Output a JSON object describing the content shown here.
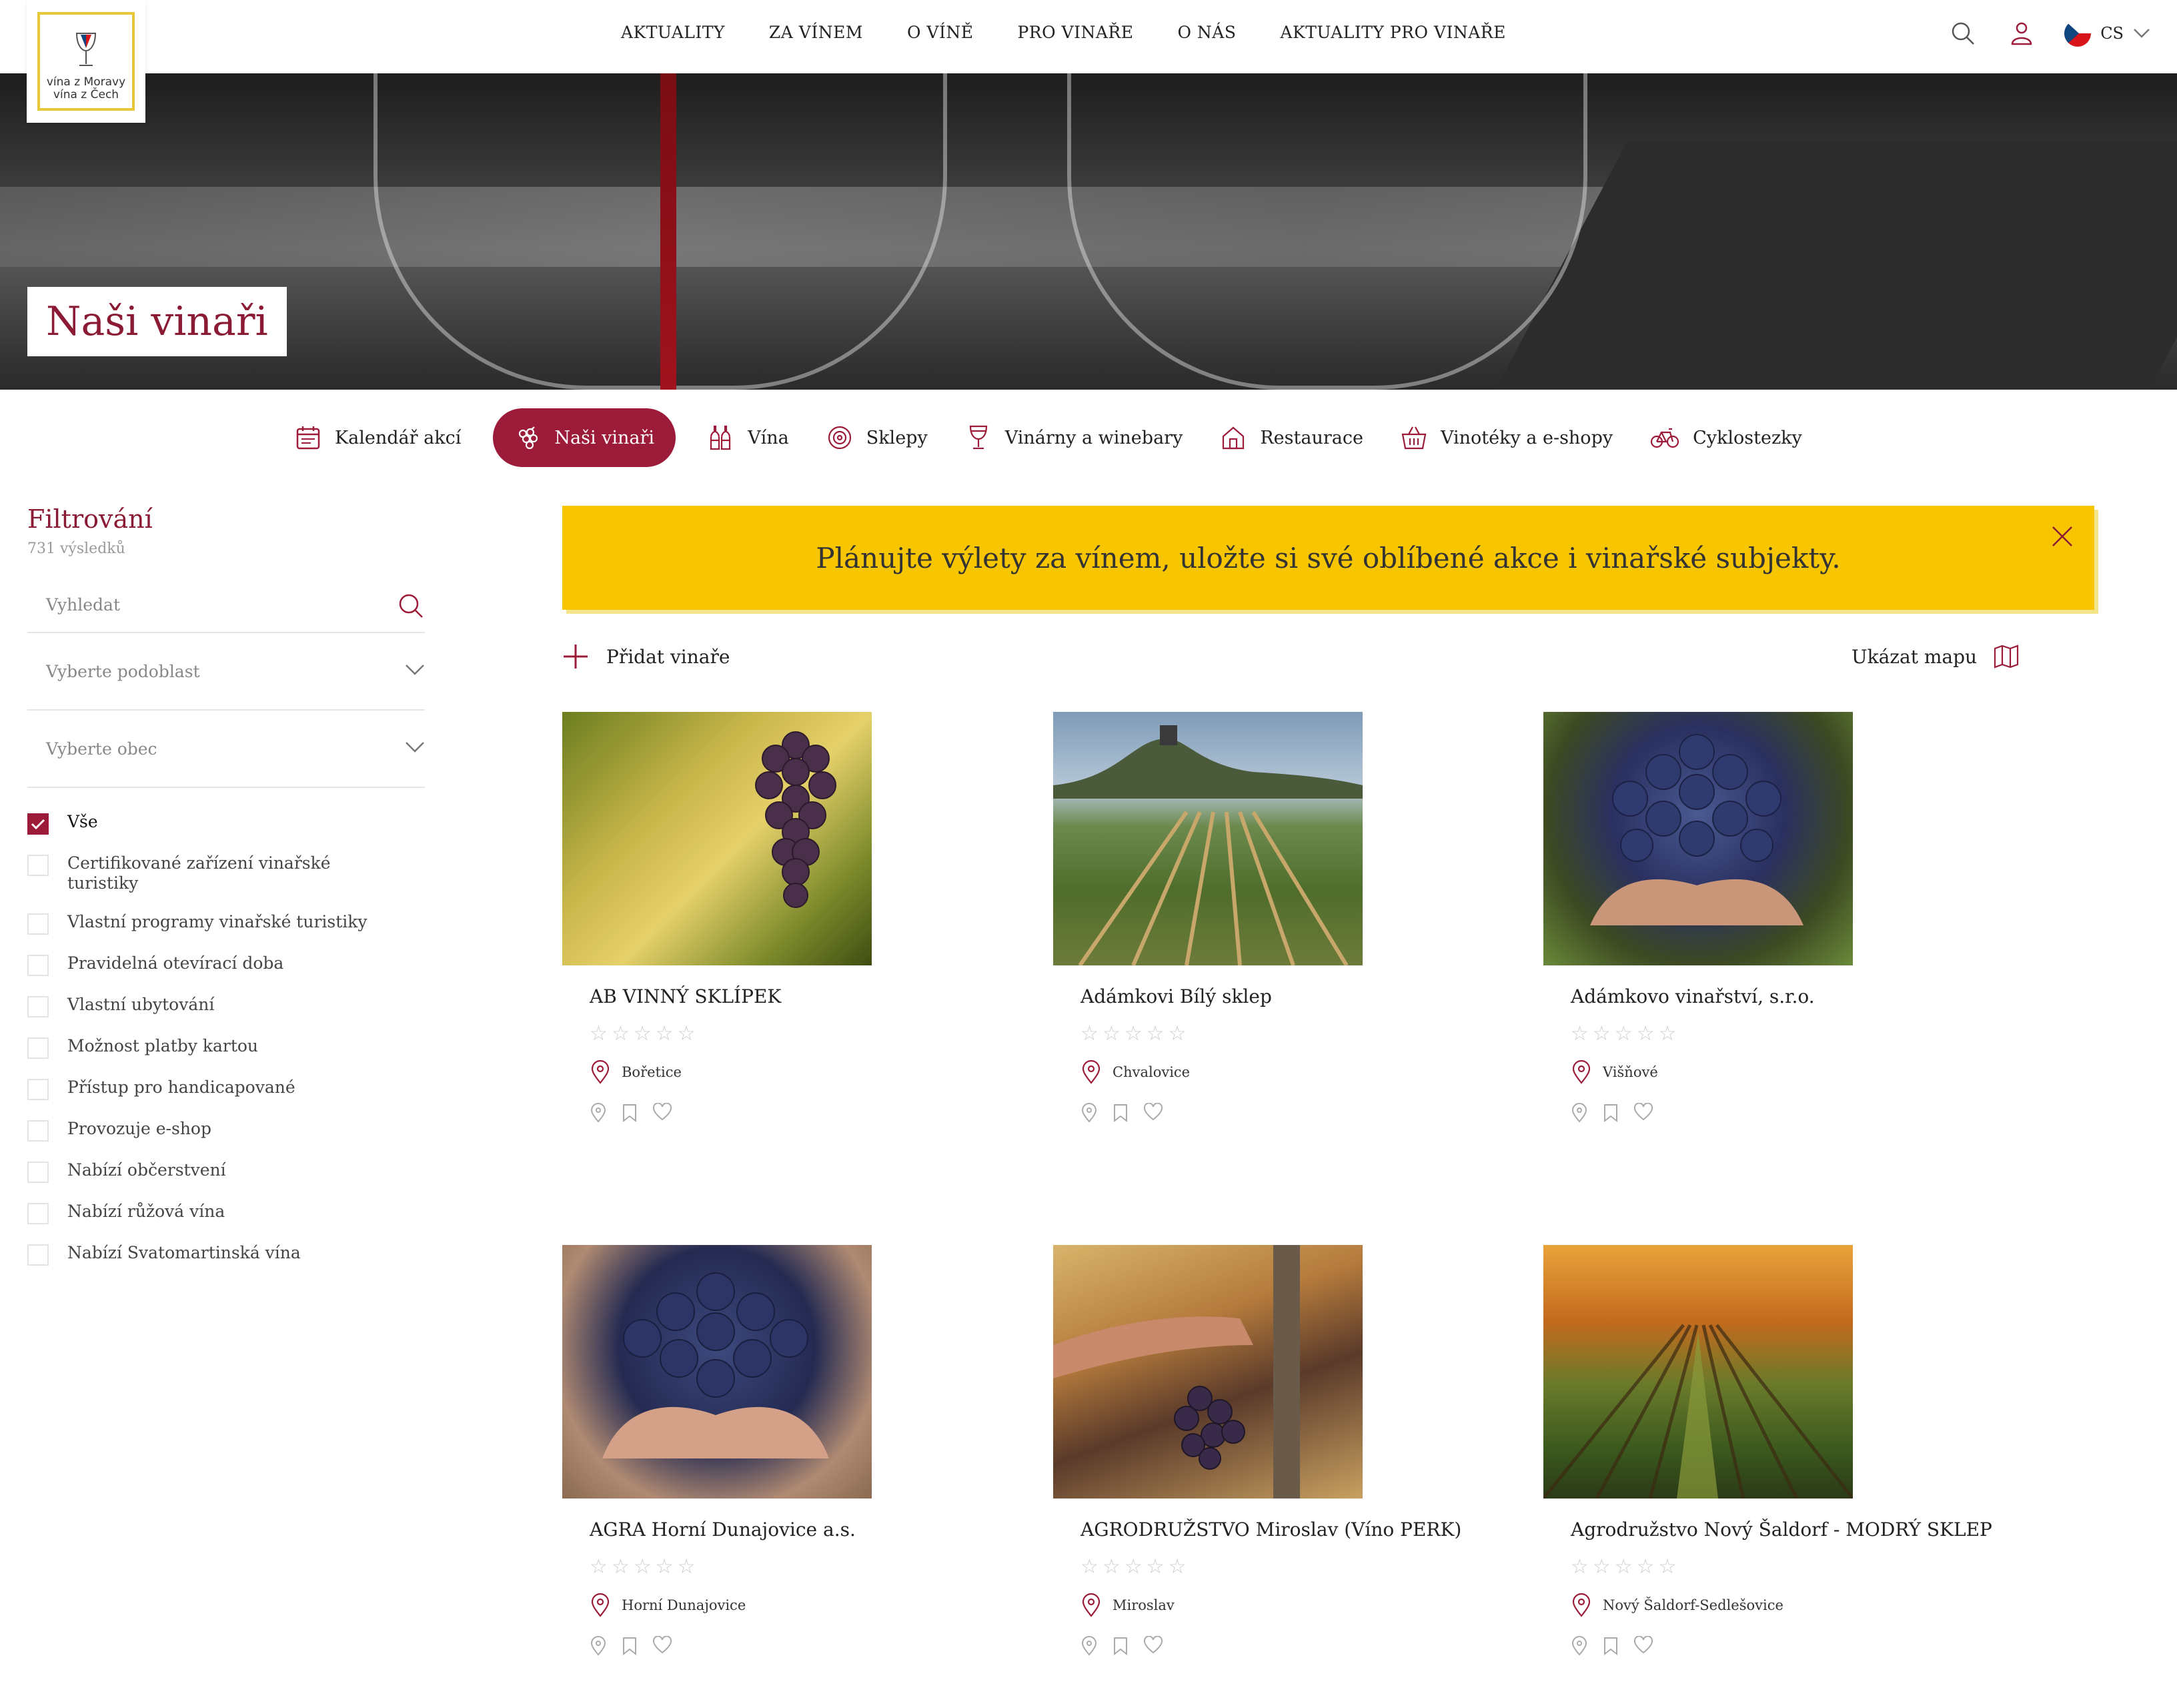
{
  "logo": {
    "line1": "vína z Moravy",
    "line2": "vína z Čech"
  },
  "nav": {
    "items": [
      "AKTUALITY",
      "ZA VÍNEM",
      "O VÍNĚ",
      "PRO VINAŘE",
      "O NÁS",
      "AKTUALITY PRO VINAŘE"
    ],
    "lang": "CS"
  },
  "hero": {
    "title": "Naši vinaři"
  },
  "categories": [
    {
      "label": "Kalendář akcí",
      "icon": "calendar-icon"
    },
    {
      "label": "Naši vinaři",
      "icon": "grapes-icon",
      "active": true
    },
    {
      "label": "Vína",
      "icon": "bottles-icon"
    },
    {
      "label": "Sklepy",
      "icon": "barrel-icon"
    },
    {
      "label": "Vinárny a winebary",
      "icon": "wine-glass-icon"
    },
    {
      "label": "Restaurace",
      "icon": "house-icon"
    },
    {
      "label": "Vinotéky a e-shopy",
      "icon": "basket-icon"
    },
    {
      "label": "Cyklostezky",
      "icon": "bicycle-icon"
    }
  ],
  "filter": {
    "title": "Filtrování",
    "count": "731 výsledků",
    "search_placeholder": "Vyhledat",
    "subregion_placeholder": "Vyberte podoblast",
    "town_placeholder": "Vyberte obec",
    "options": [
      {
        "label": "Vše",
        "checked": true
      },
      {
        "label": "Certifikované zařízení vinařské turistiky",
        "checked": false
      },
      {
        "label": "Vlastní programy vinařské turistiky",
        "checked": false
      },
      {
        "label": "Pravidelná otevírací doba",
        "checked": false
      },
      {
        "label": "Vlastní ubytování",
        "checked": false
      },
      {
        "label": "Možnost platby kartou",
        "checked": false
      },
      {
        "label": "Přístup pro handicapované",
        "checked": false
      },
      {
        "label": "Provozuje e-shop",
        "checked": false
      },
      {
        "label": "Nabízí občerstvení",
        "checked": false
      },
      {
        "label": "Nabízí růžová vína",
        "checked": false
      },
      {
        "label": "Nabízí Svatomartinská vína",
        "checked": false
      }
    ]
  },
  "banner": {
    "text": "Plánujte výlety za vínem, uložte si své oblíbené akce i vinařské subjekty."
  },
  "toolbar": {
    "add_label": "Přidat vinaře",
    "map_label": "Ukázat mapu"
  },
  "winemakers": [
    {
      "name": "AB VINNÝ SKLÍPEK",
      "town": "Bořetice",
      "rating": 0
    },
    {
      "name": "Adámkovi Bílý sklep",
      "town": "Chvalovice",
      "rating": 0
    },
    {
      "name": "Adámkovo vinařství, s.r.o.",
      "town": "Višňové",
      "rating": 0
    },
    {
      "name": "AGRA Horní Dunajovice a.s.",
      "town": "Horní Dunajovice",
      "rating": 0
    },
    {
      "name": "AGRODRUŽSTVO Miroslav (Víno PERK)",
      "town": "Miroslav",
      "rating": 0
    },
    {
      "name": "Agrodružstvo Nový Šaldorf - MODRÝ SKLEP",
      "town": "Nový Šaldorf-Sedlešovice",
      "rating": 0
    }
  ],
  "colors": {
    "accent": "#9c1b38",
    "banner": "#f7c600",
    "logo_border": "#e6c83a"
  }
}
